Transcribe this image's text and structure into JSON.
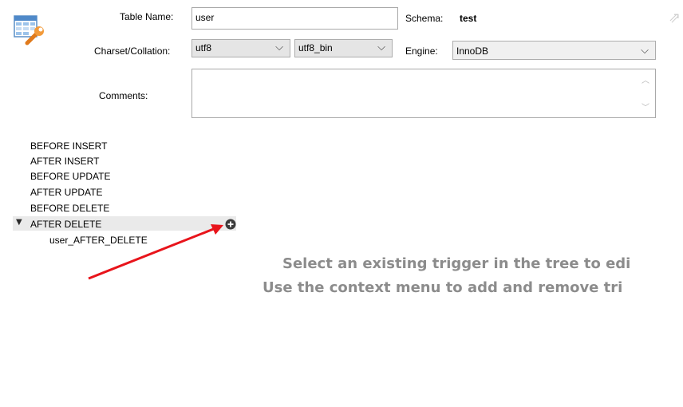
{
  "header": {
    "table_icon": "table-wrench-icon",
    "table_name_label": "Table Name:",
    "table_name_value": "user",
    "schema_label": "Schema:",
    "schema_value": "test",
    "charset_label": "Charset/Collation:",
    "charset_value": "utf8",
    "collation_value": "utf8_bin",
    "engine_label": "Engine:",
    "engine_value": "InnoDB",
    "comments_label": "Comments:",
    "comments_value": ""
  },
  "triggers": {
    "items": [
      {
        "label": "BEFORE INSERT"
      },
      {
        "label": "AFTER INSERT"
      },
      {
        "label": "BEFORE UPDATE"
      },
      {
        "label": "AFTER UPDATE"
      },
      {
        "label": "BEFORE DELETE"
      },
      {
        "label": "AFTER DELETE",
        "expanded": true,
        "children": [
          {
            "label": "user_AFTER_DELETE"
          }
        ]
      }
    ],
    "add_icon": "plus-circle-icon",
    "expand_icon": "triangle-down-icon"
  },
  "main": {
    "hint_line1": "Select an existing trigger in the tree to edi",
    "hint_line2": "Use the context menu to add and remove tri"
  },
  "colors": {
    "arrow": "#e8141b",
    "hint_text": "#8c8c8c",
    "selected_row": "#eaeaea"
  }
}
